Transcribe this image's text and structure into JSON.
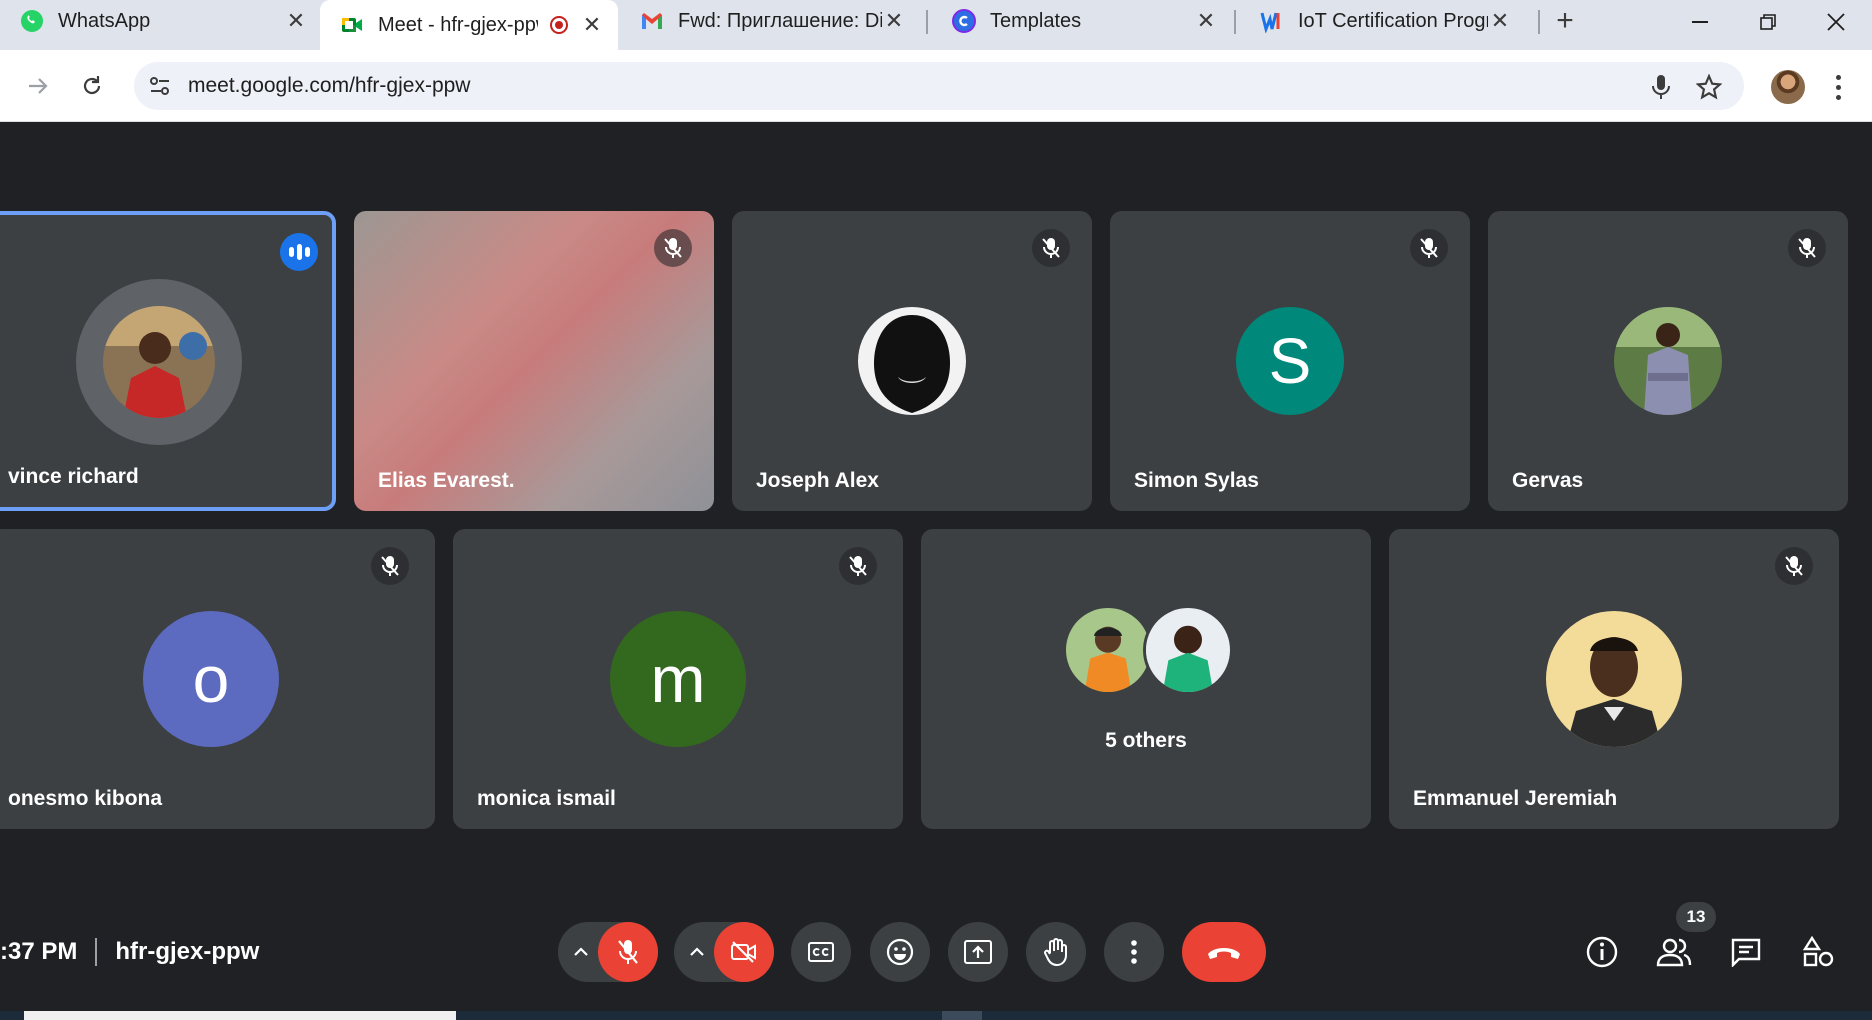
{
  "browser": {
    "tabs": [
      {
        "title": "WhatsApp",
        "icon": "whatsapp-icon",
        "active": false
      },
      {
        "title": "Meet - hfr-gjex-ppw",
        "icon": "google-meet-icon",
        "active": true,
        "recording": true
      },
      {
        "title": "Fwd: Приглашение: Dian",
        "icon": "gmail-icon",
        "active": false
      },
      {
        "title": "Templates",
        "icon": "canva-icon",
        "active": false
      },
      {
        "title": "IoT Certification Program",
        "icon": "webflow-icon",
        "active": false
      }
    ],
    "new_tab_label": "+",
    "url": "meet.google.com/hfr-gjex-ppw"
  },
  "meeting": {
    "time": ":37 PM",
    "code": "hfr-gjex-ppw",
    "participant_count": "13",
    "others_label": "5 others"
  },
  "participants_row1": [
    {
      "name": "vince richard",
      "speaking": true,
      "avatar": "photo"
    },
    {
      "name": "Elias Evarest.",
      "muted": true,
      "avatar": "video-blur"
    },
    {
      "name": "Joseph Alex",
      "muted": true,
      "avatar": "photo"
    },
    {
      "name": "Simon Sylas",
      "muted": true,
      "avatar_letter": "S",
      "avatar_color": "#00897b"
    },
    {
      "name": "Gervas",
      "muted": true,
      "avatar": "photo"
    }
  ],
  "participants_row2": [
    {
      "name": "onesmo kibona",
      "muted": true,
      "avatar_letter": "o",
      "avatar_color": "#5c6bc0"
    },
    {
      "name": "monica ismail",
      "muted": true,
      "avatar_letter": "m",
      "avatar_color": "#33691e"
    },
    {
      "name": "Emmanuel Jeremiah",
      "muted": true,
      "avatar": "photo"
    }
  ],
  "colors": {
    "background": "#202124",
    "tile": "#3c4043",
    "danger": "#ea4335",
    "speaking_border": "#6c9ff5"
  }
}
